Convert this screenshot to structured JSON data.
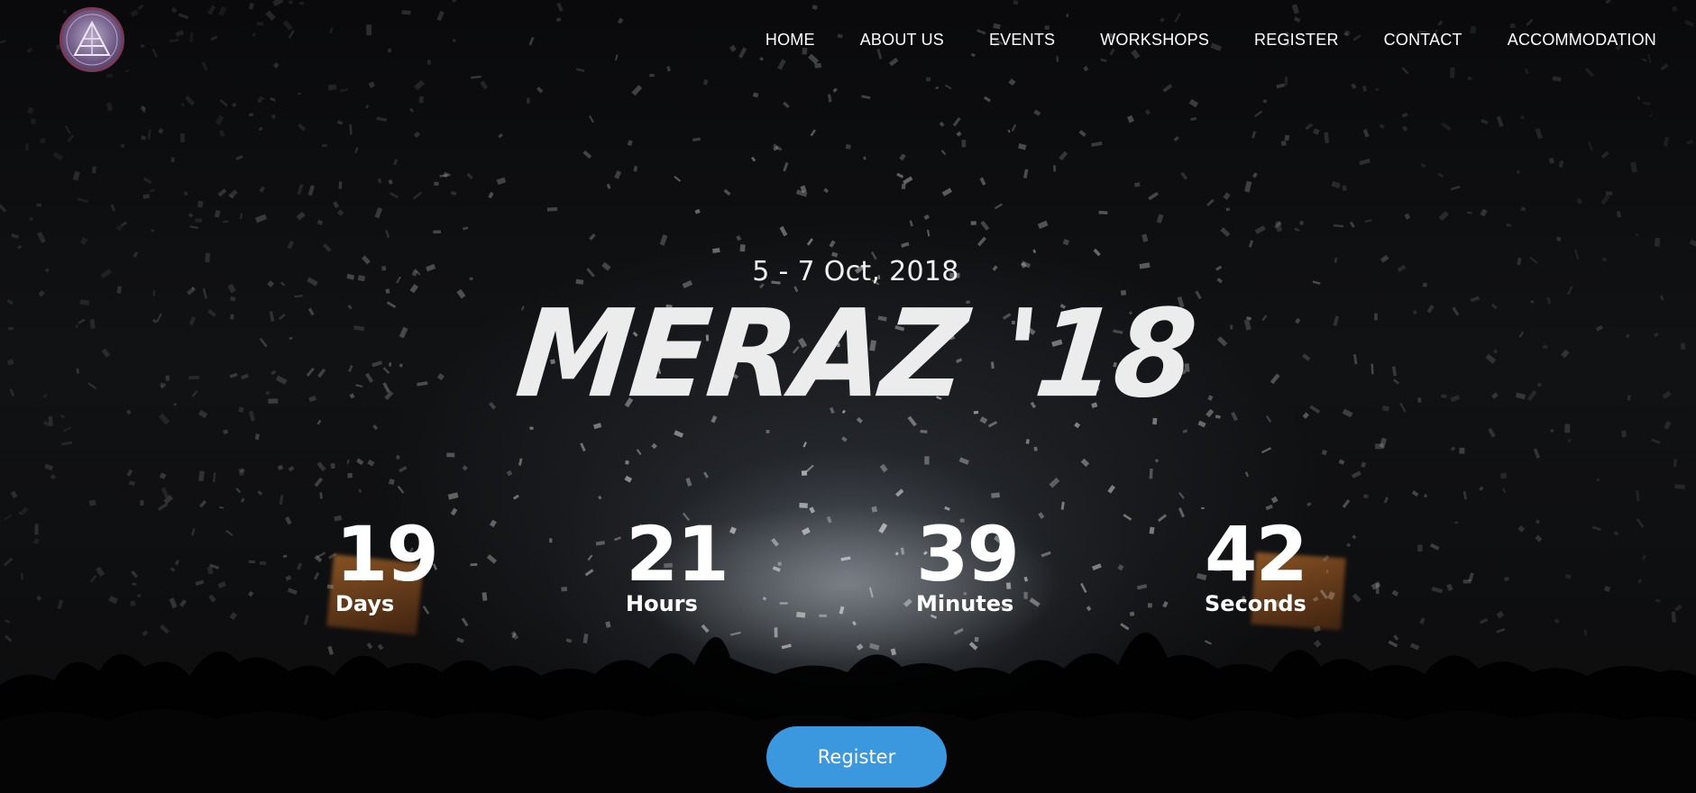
{
  "nav": {
    "logo_alt": "Meraz logo",
    "links": [
      {
        "label": "HOME"
      },
      {
        "label": "ABOUT US"
      },
      {
        "label": "EVENTS"
      },
      {
        "label": "WORKSHOPS"
      },
      {
        "label": "REGISTER"
      },
      {
        "label": "CONTACT"
      },
      {
        "label": "ACCOMMODATION"
      }
    ]
  },
  "hero": {
    "date": "5 - 7 Oct, 2018",
    "title": "MERAZ '18",
    "countdown": [
      {
        "value": "19",
        "label": "Days"
      },
      {
        "value": "21",
        "label": "Hours"
      },
      {
        "value": "39",
        "label": "Minutes"
      },
      {
        "value": "42",
        "label": "Seconds"
      }
    ],
    "register_label": "Register"
  },
  "colors": {
    "accent": "#3b97de",
    "text": "#ffffff",
    "background": "#0c0c0d"
  }
}
